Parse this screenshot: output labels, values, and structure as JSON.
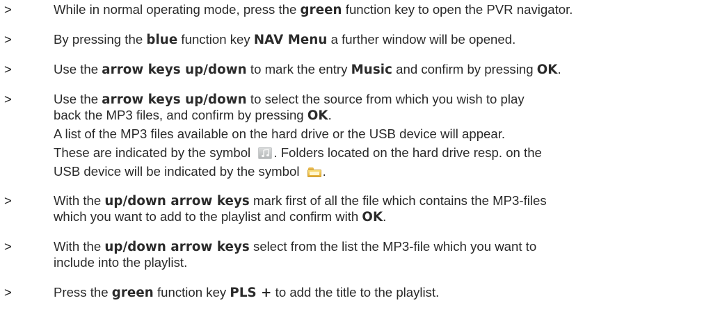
{
  "marker": ">",
  "steps": [
    {
      "lines": [
        [
          {
            "t": "While in normal operating mode, press the "
          },
          {
            "t": "green",
            "b": true
          },
          {
            "t": " function key to open the PVR navigator."
          }
        ]
      ]
    },
    {
      "lines": [
        [
          {
            "t": "By pressing the "
          },
          {
            "t": "blue",
            "b": true
          },
          {
            "t": " function key "
          },
          {
            "t": "NAV Menu",
            "b": true
          },
          {
            "t": " a further window will be opened."
          }
        ]
      ]
    },
    {
      "lines": [
        [
          {
            "t": "Use the "
          },
          {
            "t": "arrow keys up/down",
            "b": true
          },
          {
            "t": " to mark the entry "
          },
          {
            "t": "Music",
            "b": true
          },
          {
            "t": " and confirm by pressing "
          },
          {
            "t": "OK",
            "b": true
          },
          {
            "t": "."
          }
        ]
      ]
    },
    {
      "lines": [
        [
          {
            "t": "Use the "
          },
          {
            "t": "arrow keys up/down",
            "b": true
          },
          {
            "t": " to select the source from which you wish to play"
          }
        ],
        [
          {
            "t": "back the MP3 files, and confirm by pressing "
          },
          {
            "t": "OK",
            "b": true
          },
          {
            "t": "."
          }
        ],
        [
          {
            "t": "A list of the MP3 files available on the hard drive or the USB device will appear."
          }
        ],
        [
          {
            "t": "These are indicated by the symbol "
          },
          {
            "icon": "music-file-icon"
          },
          {
            "t": ". Folders located on the hard drive resp. on the"
          }
        ],
        [
          {
            "t": "USB device will be indicated by the symbol "
          },
          {
            "icon": "folder-icon"
          },
          {
            "t": "."
          }
        ]
      ]
    },
    {
      "lines": [
        [
          {
            "t": "With the "
          },
          {
            "t": "up/down arrow keys",
            "b": true
          },
          {
            "t": " mark first of all the file which contains the MP3-files"
          }
        ],
        [
          {
            "t": "which you want to add to the playlist and confirm with "
          },
          {
            "t": "OK",
            "b": true
          },
          {
            "t": "."
          }
        ]
      ]
    },
    {
      "lines": [
        [
          {
            "t": "With the "
          },
          {
            "t": "up/down arrow keys",
            "b": true
          },
          {
            "t": " select from the list the MP3-file which you want to"
          }
        ],
        [
          {
            "t": "include into the playlist."
          }
        ]
      ]
    },
    {
      "lines": [
        [
          {
            "t": "Press the "
          },
          {
            "t": "green",
            "b": true
          },
          {
            "t": " function key "
          },
          {
            "t": "PLS +",
            "b": true
          },
          {
            "t": " to add the title to the playlist."
          }
        ]
      ]
    }
  ]
}
